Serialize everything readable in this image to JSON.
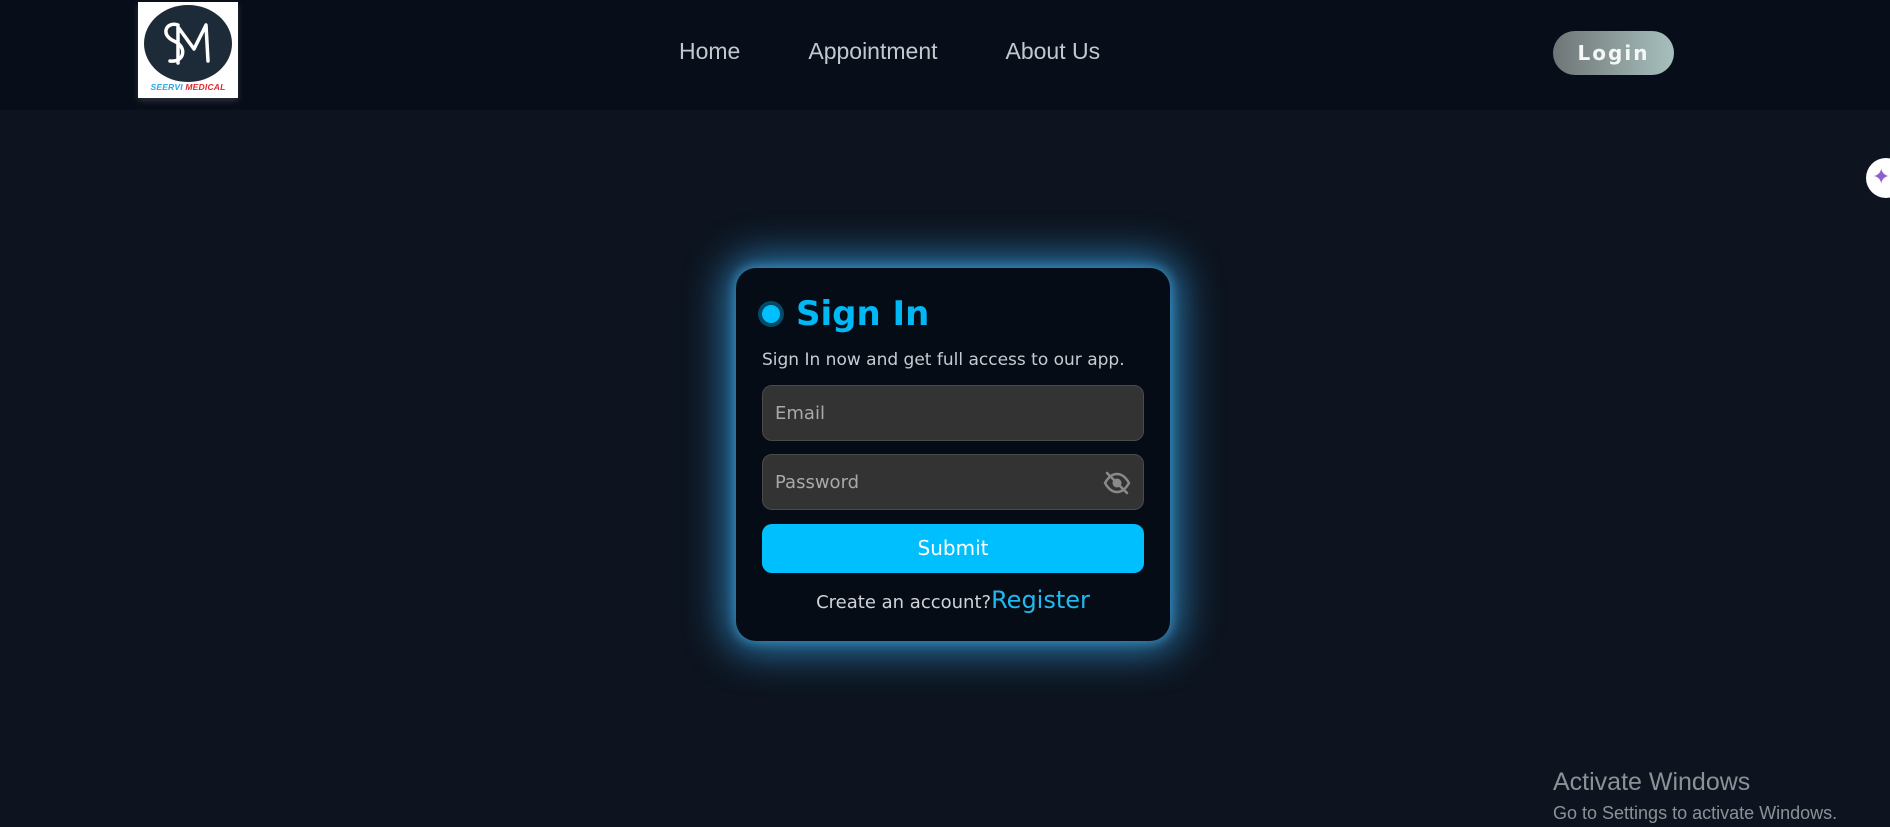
{
  "header": {
    "logo_text_1": "SEERVI",
    "logo_text_2": "MEDICAL",
    "nav": [
      {
        "label": "Home"
      },
      {
        "label": "Appointment"
      },
      {
        "label": "About Us"
      }
    ],
    "login_label": "Login"
  },
  "side_widget": {
    "icon": "sparkle-icon"
  },
  "signin": {
    "title": "Sign In",
    "subtitle": "Sign In now and get full access to our app.",
    "email_placeholder": "Email",
    "password_placeholder": "Password",
    "password_toggle_icon": "eye-off-icon",
    "submit_label": "Submit",
    "register_prompt": "Create an account?",
    "register_link": "Register"
  },
  "os_notice": {
    "line1": "Activate Windows",
    "line2": "Go to Settings to activate Windows."
  },
  "colors": {
    "accent": "#00bfff",
    "background": "#0d141f",
    "navbar": "#080e19",
    "card": "#060c16",
    "glow": "#36a0e4"
  }
}
